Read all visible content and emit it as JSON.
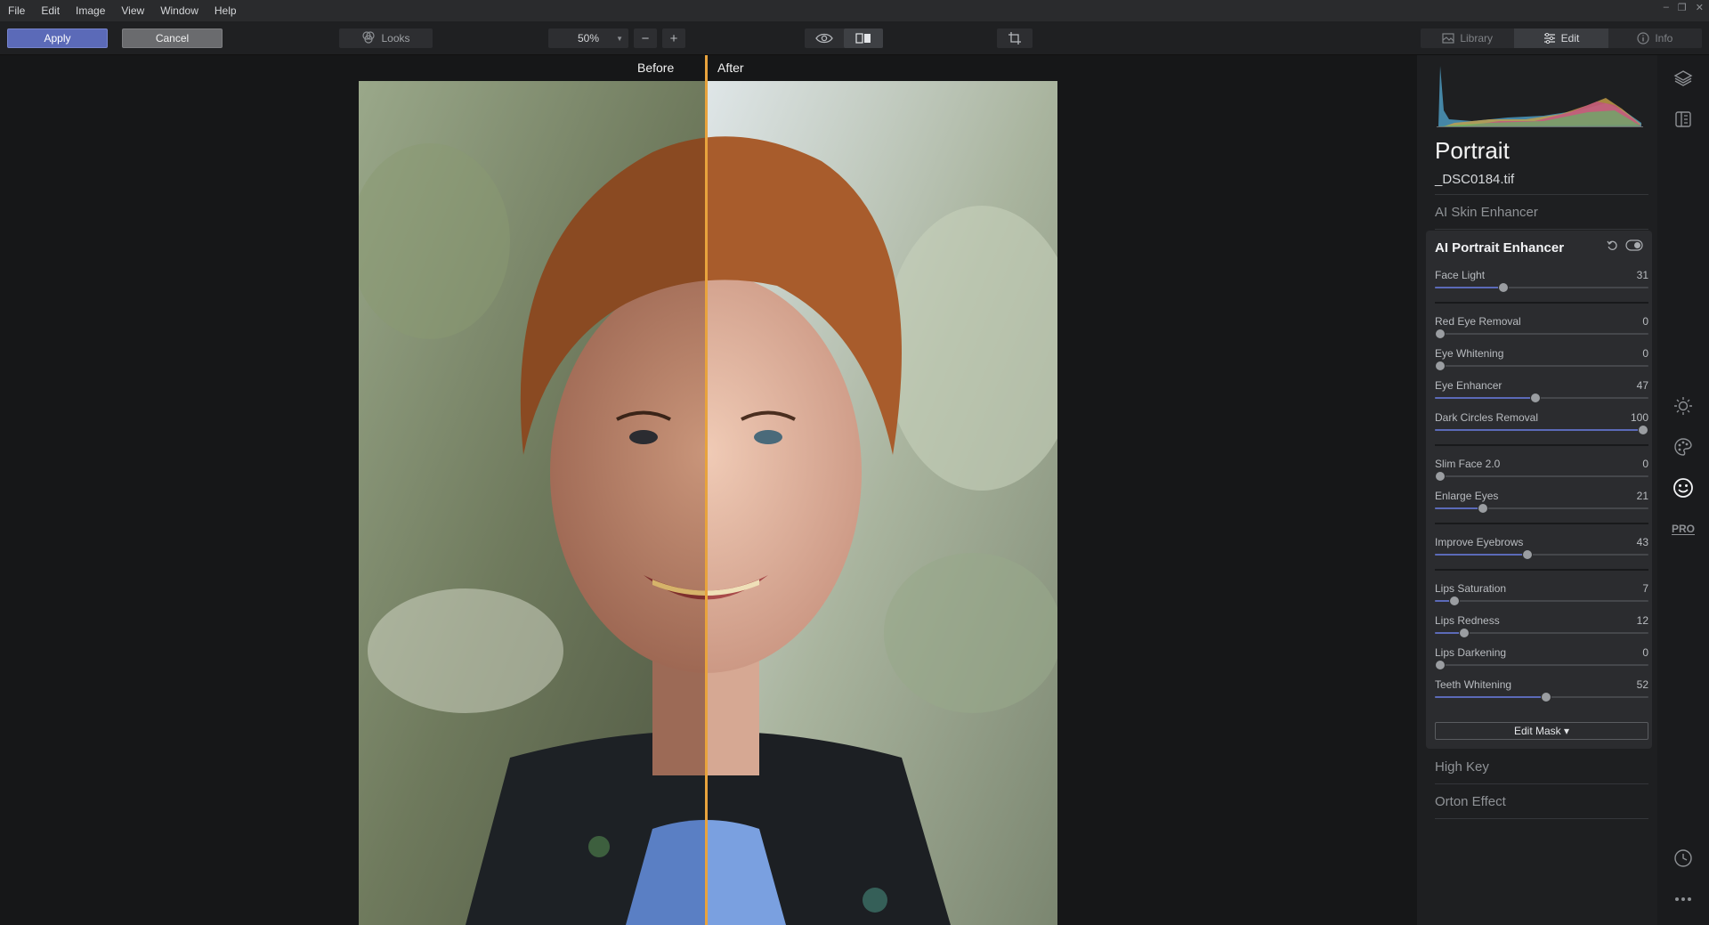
{
  "menu": [
    "File",
    "Edit",
    "Image",
    "View",
    "Window",
    "Help"
  ],
  "toolbar": {
    "apply_label": "Apply",
    "cancel_label": "Cancel",
    "looks_label": "Looks",
    "zoom_value": "50%",
    "zoom_out": "−",
    "zoom_in": "+"
  },
  "mode_tabs": [
    {
      "label": "Library",
      "icon": "library-icon",
      "active": false
    },
    {
      "label": "Edit",
      "icon": "sliders-icon",
      "active": true
    },
    {
      "label": "Info",
      "icon": "info-icon",
      "active": false
    }
  ],
  "compare": {
    "before_label": "Before",
    "after_label": "After"
  },
  "panel": {
    "title": "Portrait",
    "filename": "_DSC0184.tif",
    "sections_above": [
      "AI Skin Enhancer"
    ],
    "sections_below": [
      "High Key",
      "Orton Effect"
    ],
    "active_section": {
      "title": "AI Portrait Enhancer",
      "mask_label": "Edit Mask ▾",
      "groups": [
        [
          {
            "label": "Face Light",
            "value": 31
          }
        ],
        [
          {
            "label": "Red Eye Removal",
            "value": 0
          },
          {
            "label": "Eye Whitening",
            "value": 0
          },
          {
            "label": "Eye Enhancer",
            "value": 47
          },
          {
            "label": "Dark Circles Removal",
            "value": 100
          }
        ],
        [
          {
            "label": "Slim Face 2.0",
            "value": 0
          },
          {
            "label": "Enlarge Eyes",
            "value": 21
          }
        ],
        [
          {
            "label": "Improve Eyebrows",
            "value": 43
          }
        ],
        [
          {
            "label": "Lips Saturation",
            "value": 7
          },
          {
            "label": "Lips Redness",
            "value": 12
          },
          {
            "label": "Lips Darkening",
            "value": 0
          },
          {
            "label": "Teeth Whitening",
            "value": 52
          }
        ]
      ]
    }
  },
  "rail_icons": [
    "layers-icon",
    "presets-icon",
    "sun-icon",
    "palette-icon",
    "smile-icon",
    "pro-icon",
    "history-icon",
    "more-icon"
  ],
  "rail_pro_label": "PRO",
  "colors": {
    "accent": "#5b6ab8",
    "divider": "#e8a33d"
  }
}
